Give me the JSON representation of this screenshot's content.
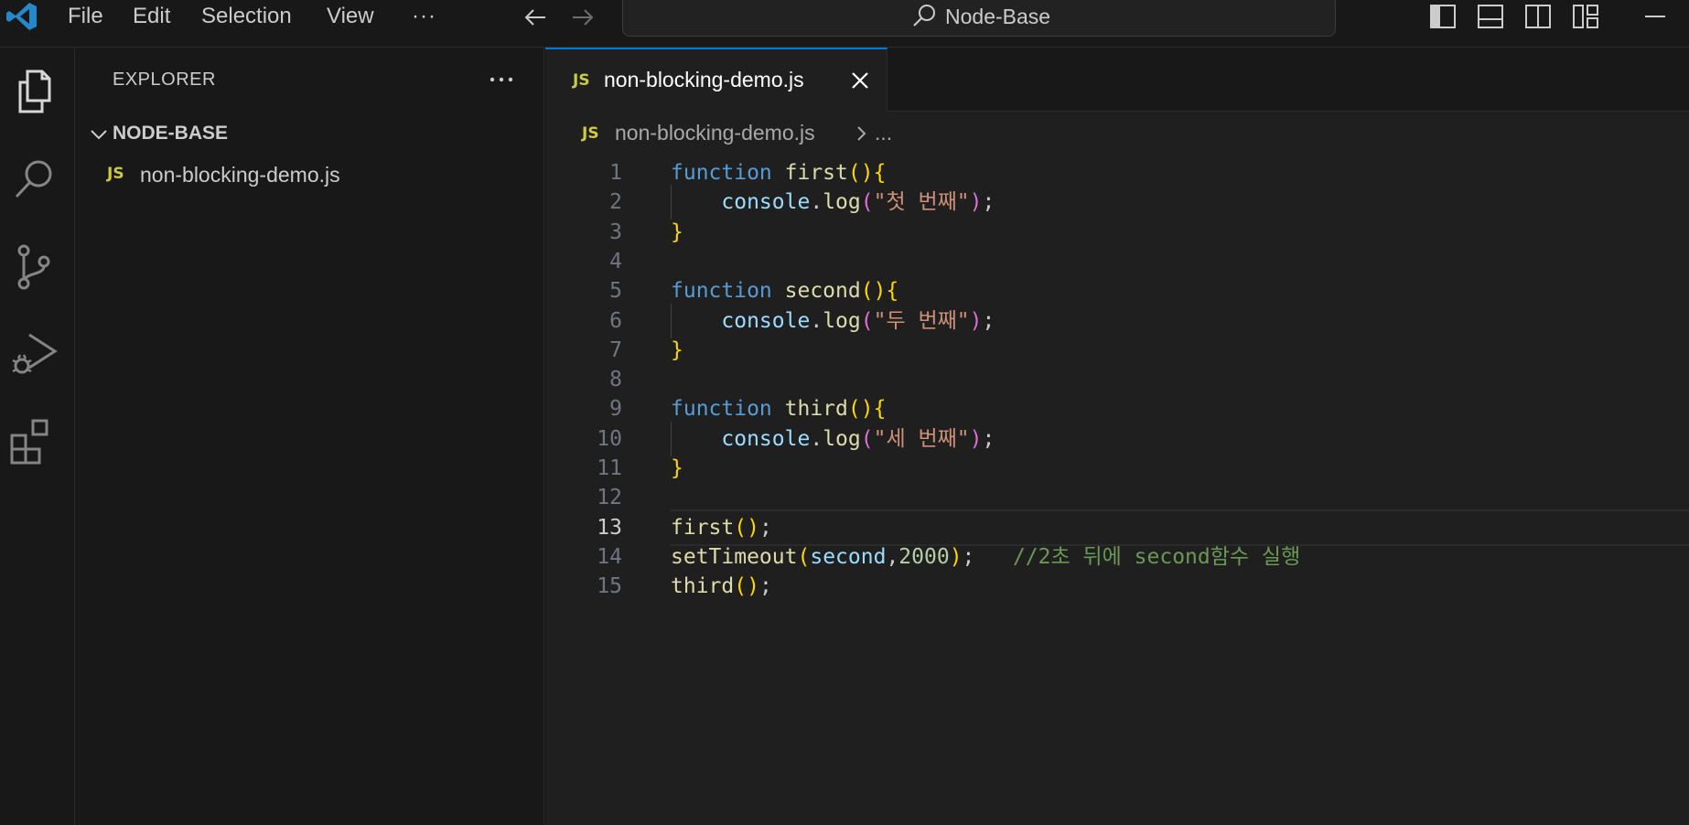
{
  "titlebar": {
    "menu": [
      "File",
      "Edit",
      "Selection",
      "View",
      "···"
    ],
    "command_center": "Node-Base"
  },
  "sidebar": {
    "title": "EXPLORER",
    "more": "···",
    "folder": "NODE-BASE",
    "files": [
      {
        "badge": "JS",
        "name": "non-blocking-demo.js"
      }
    ]
  },
  "tab": {
    "badge": "JS",
    "label": "non-blocking-demo.js"
  },
  "breadcrumb": {
    "badge": "JS",
    "file": "non-blocking-demo.js",
    "rest": "..."
  },
  "editor": {
    "current_line": 13,
    "lines": [
      {
        "n": "1",
        "text": "function first(){"
      },
      {
        "n": "2",
        "text": "    console.log(\"첫 번째\");"
      },
      {
        "n": "3",
        "text": "}"
      },
      {
        "n": "4",
        "text": ""
      },
      {
        "n": "5",
        "text": "function second(){"
      },
      {
        "n": "6",
        "text": "    console.log(\"두 번째\");"
      },
      {
        "n": "7",
        "text": "}"
      },
      {
        "n": "8",
        "text": ""
      },
      {
        "n": "9",
        "text": "function third(){"
      },
      {
        "n": "10",
        "text": "    console.log(\"세 번째\");"
      },
      {
        "n": "11",
        "text": "}"
      },
      {
        "n": "12",
        "text": ""
      },
      {
        "n": "13",
        "text": "first();"
      },
      {
        "n": "14",
        "text": "setTimeout(second,2000);   //2초 뒤에 second함수 실행"
      },
      {
        "n": "15",
        "text": "third();"
      }
    ],
    "tokens": {
      "1": [
        [
          "kw",
          "function"
        ],
        [
          "pl",
          " "
        ],
        [
          "fn",
          "first"
        ],
        [
          "br1",
          "(){"
        ]
      ],
      "2": [
        [
          "pl",
          "    "
        ],
        [
          "var",
          "console"
        ],
        [
          "pl",
          "."
        ],
        [
          "fn",
          "log"
        ],
        [
          "br2",
          "("
        ],
        [
          "str",
          "\"첫 번째\""
        ],
        [
          "br2",
          ")"
        ],
        [
          "pl",
          ";"
        ]
      ],
      "3": [
        [
          "br1",
          "}"
        ]
      ],
      "5": [
        [
          "kw",
          "function"
        ],
        [
          "pl",
          " "
        ],
        [
          "fn",
          "second"
        ],
        [
          "br1",
          "(){"
        ]
      ],
      "6": [
        [
          "pl",
          "    "
        ],
        [
          "var",
          "console"
        ],
        [
          "pl",
          "."
        ],
        [
          "fn",
          "log"
        ],
        [
          "br2",
          "("
        ],
        [
          "str",
          "\"두 번째\""
        ],
        [
          "br2",
          ")"
        ],
        [
          "pl",
          ";"
        ]
      ],
      "7": [
        [
          "br1",
          "}"
        ]
      ],
      "9": [
        [
          "kw",
          "function"
        ],
        [
          "pl",
          " "
        ],
        [
          "fn",
          "third"
        ],
        [
          "br1",
          "(){"
        ]
      ],
      "10": [
        [
          "pl",
          "    "
        ],
        [
          "var",
          "console"
        ],
        [
          "pl",
          "."
        ],
        [
          "fn",
          "log"
        ],
        [
          "br2",
          "("
        ],
        [
          "str",
          "\"세 번째\""
        ],
        [
          "br2",
          ")"
        ],
        [
          "pl",
          ";"
        ]
      ],
      "11": [
        [
          "br1",
          "}"
        ]
      ],
      "13": [
        [
          "fn",
          "first"
        ],
        [
          "br1",
          "()"
        ],
        [
          "pl",
          ";"
        ]
      ],
      "14": [
        [
          "fn",
          "setTimeout"
        ],
        [
          "br1",
          "("
        ],
        [
          "var",
          "second"
        ],
        [
          "pl",
          ","
        ],
        [
          "num",
          "2000"
        ],
        [
          "br1",
          ")"
        ],
        [
          "pl",
          ";   "
        ],
        [
          "cm",
          "//2초 뒤에 second함수 실행"
        ]
      ],
      "15": [
        [
          "fn",
          "third"
        ],
        [
          "br1",
          "()"
        ],
        [
          "pl",
          ";"
        ]
      ]
    }
  },
  "colors": {
    "background": "#181818",
    "editor_background": "#1f1f1f",
    "accent": "#0078d4",
    "keyword": "#569cd6",
    "function": "#dcdcaa",
    "string": "#ce9178",
    "variable": "#9cdcfe",
    "number": "#b5cea8",
    "comment": "#6a9955",
    "bracket1": "#ffd700",
    "bracket2": "#da70d6",
    "js_badge": "#cbcb41"
  },
  "icons": {
    "activity": [
      "files-icon",
      "search-icon",
      "source-control-icon",
      "run-debug-icon",
      "extensions-icon"
    ],
    "layout": [
      "toggle-primary-sidebar-icon",
      "toggle-panel-icon",
      "toggle-secondary-sidebar-icon",
      "customize-layout-icon"
    ]
  }
}
